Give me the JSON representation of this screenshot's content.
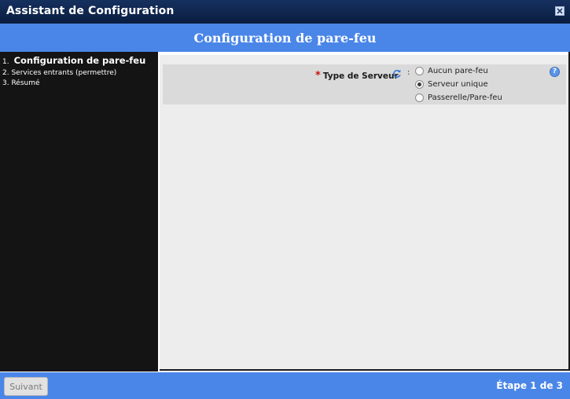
{
  "window": {
    "title": "Assistant de Configuration",
    "close_icon": "close-icon"
  },
  "header": {
    "title": "Configuration de pare-feu"
  },
  "sidebar": {
    "steps": [
      {
        "num": "1.",
        "label": "Configuration de pare-feu",
        "active": true
      },
      {
        "label": "2. Services entrants (permettre)",
        "active": false
      },
      {
        "label": "3. Résumé",
        "active": false
      }
    ]
  },
  "form": {
    "field": {
      "required_mark": "*",
      "label": "Type de Serveur",
      "separator": ":",
      "options": [
        {
          "label": "Aucun pare-feu",
          "checked": false
        },
        {
          "label": "Serveur unique",
          "checked": true
        },
        {
          "label": "Passerelle/Pare-feu",
          "checked": false
        }
      ],
      "selected": "Serveur unique"
    },
    "help_icon": "?"
  },
  "footer": {
    "next_label": "Suivant",
    "step_indicator": "Étape 1 de 3"
  },
  "colors": {
    "titlebar": "#0f2550",
    "accent": "#4a86e8",
    "sidebar": "#141414",
    "content": "#ededed",
    "form_row": "#dadada",
    "required": "#cc1111"
  }
}
